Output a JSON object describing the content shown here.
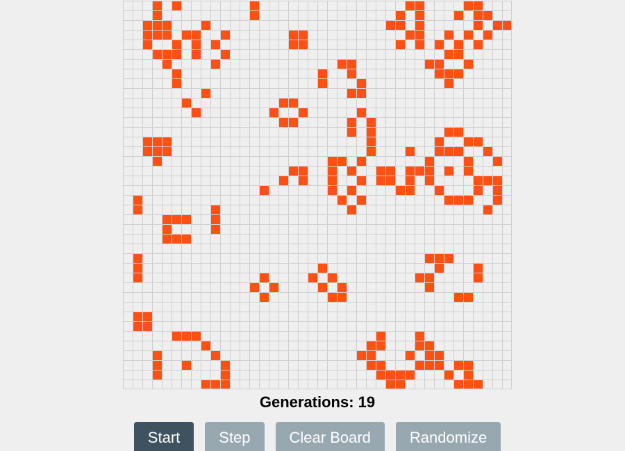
{
  "game": {
    "rows": 40,
    "cols": 40,
    "alive_color": "#ff5014",
    "dead_color": "#efefef",
    "grid_line_color": "#cfcfcf",
    "alive_cells": [
      [
        0,
        3
      ],
      [
        0,
        5
      ],
      [
        0,
        13
      ],
      [
        0,
        29
      ],
      [
        0,
        30
      ],
      [
        0,
        35
      ],
      [
        0,
        36
      ],
      [
        1,
        3
      ],
      [
        1,
        13
      ],
      [
        1,
        28
      ],
      [
        1,
        30
      ],
      [
        1,
        34
      ],
      [
        1,
        36
      ],
      [
        1,
        37
      ],
      [
        2,
        2
      ],
      [
        2,
        3
      ],
      [
        2,
        4
      ],
      [
        2,
        8
      ],
      [
        2,
        27
      ],
      [
        2,
        28
      ],
      [
        2,
        30
      ],
      [
        2,
        36
      ],
      [
        2,
        38
      ],
      [
        2,
        39
      ],
      [
        3,
        2
      ],
      [
        3,
        3
      ],
      [
        3,
        4
      ],
      [
        3,
        6
      ],
      [
        3,
        7
      ],
      [
        3,
        10
      ],
      [
        3,
        17
      ],
      [
        3,
        18
      ],
      [
        3,
        29
      ],
      [
        3,
        30
      ],
      [
        3,
        33
      ],
      [
        3,
        35
      ],
      [
        3,
        37
      ],
      [
        4,
        2
      ],
      [
        4,
        5
      ],
      [
        4,
        7
      ],
      [
        4,
        9
      ],
      [
        4,
        17
      ],
      [
        4,
        18
      ],
      [
        4,
        28
      ],
      [
        4,
        30
      ],
      [
        4,
        32
      ],
      [
        4,
        34
      ],
      [
        4,
        36
      ],
      [
        5,
        3
      ],
      [
        5,
        4
      ],
      [
        5,
        5
      ],
      [
        5,
        7
      ],
      [
        5,
        10
      ],
      [
        5,
        33
      ],
      [
        5,
        34
      ],
      [
        6,
        4
      ],
      [
        6,
        9
      ],
      [
        6,
        22
      ],
      [
        6,
        23
      ],
      [
        6,
        31
      ],
      [
        6,
        32
      ],
      [
        6,
        35
      ],
      [
        7,
        5
      ],
      [
        7,
        20
      ],
      [
        7,
        23
      ],
      [
        7,
        32
      ],
      [
        7,
        33
      ],
      [
        7,
        34
      ],
      [
        8,
        5
      ],
      [
        8,
        20
      ],
      [
        8,
        24
      ],
      [
        8,
        33
      ],
      [
        9,
        8
      ],
      [
        9,
        23
      ],
      [
        9,
        24
      ],
      [
        10,
        6
      ],
      [
        10,
        16
      ],
      [
        10,
        17
      ],
      [
        11,
        7
      ],
      [
        11,
        15
      ],
      [
        11,
        18
      ],
      [
        11,
        24
      ],
      [
        12,
        16
      ],
      [
        12,
        17
      ],
      [
        12,
        23
      ],
      [
        12,
        25
      ],
      [
        13,
        23
      ],
      [
        13,
        25
      ],
      [
        13,
        33
      ],
      [
        13,
        34
      ],
      [
        14,
        2
      ],
      [
        14,
        3
      ],
      [
        14,
        4
      ],
      [
        14,
        25
      ],
      [
        14,
        32
      ],
      [
        14,
        35
      ],
      [
        14,
        36
      ],
      [
        15,
        2
      ],
      [
        15,
        3
      ],
      [
        15,
        4
      ],
      [
        15,
        25
      ],
      [
        15,
        29
      ],
      [
        15,
        32
      ],
      [
        15,
        33
      ],
      [
        15,
        34
      ],
      [
        15,
        37
      ],
      [
        16,
        3
      ],
      [
        16,
        21
      ],
      [
        16,
        22
      ],
      [
        16,
        24
      ],
      [
        16,
        31
      ],
      [
        16,
        35
      ],
      [
        16,
        38
      ],
      [
        17,
        17
      ],
      [
        17,
        18
      ],
      [
        17,
        21
      ],
      [
        17,
        23
      ],
      [
        17,
        26
      ],
      [
        17,
        27
      ],
      [
        17,
        29
      ],
      [
        17,
        30
      ],
      [
        17,
        31
      ],
      [
        17,
        33
      ],
      [
        17,
        35
      ],
      [
        18,
        16
      ],
      [
        18,
        18
      ],
      [
        18,
        21
      ],
      [
        18,
        24
      ],
      [
        18,
        26
      ],
      [
        18,
        27
      ],
      [
        18,
        29
      ],
      [
        18,
        31
      ],
      [
        18,
        36
      ],
      [
        18,
        37
      ],
      [
        18,
        38
      ],
      [
        19,
        14
      ],
      [
        19,
        21
      ],
      [
        19,
        23
      ],
      [
        19,
        28
      ],
      [
        19,
        29
      ],
      [
        19,
        32
      ],
      [
        19,
        36
      ],
      [
        19,
        38
      ],
      [
        20,
        1
      ],
      [
        20,
        22
      ],
      [
        20,
        24
      ],
      [
        20,
        33
      ],
      [
        20,
        34
      ],
      [
        20,
        35
      ],
      [
        20,
        38
      ],
      [
        21,
        1
      ],
      [
        21,
        9
      ],
      [
        21,
        23
      ],
      [
        21,
        37
      ],
      [
        22,
        4
      ],
      [
        22,
        5
      ],
      [
        22,
        6
      ],
      [
        22,
        9
      ],
      [
        23,
        4
      ],
      [
        23,
        9
      ],
      [
        24,
        4
      ],
      [
        24,
        5
      ],
      [
        24,
        6
      ],
      [
        26,
        1
      ],
      [
        26,
        31
      ],
      [
        26,
        32
      ],
      [
        26,
        33
      ],
      [
        27,
        1
      ],
      [
        27,
        20
      ],
      [
        27,
        32
      ],
      [
        27,
        36
      ],
      [
        28,
        1
      ],
      [
        28,
        14
      ],
      [
        28,
        19
      ],
      [
        28,
        21
      ],
      [
        28,
        30
      ],
      [
        28,
        31
      ],
      [
        28,
        36
      ],
      [
        29,
        13
      ],
      [
        29,
        15
      ],
      [
        29,
        20
      ],
      [
        29,
        22
      ],
      [
        29,
        31
      ],
      [
        30,
        14
      ],
      [
        30,
        21
      ],
      [
        30,
        22
      ],
      [
        30,
        34
      ],
      [
        30,
        35
      ],
      [
        32,
        1
      ],
      [
        32,
        2
      ],
      [
        33,
        1
      ],
      [
        33,
        2
      ],
      [
        34,
        5
      ],
      [
        34,
        6
      ],
      [
        34,
        7
      ],
      [
        34,
        26
      ],
      [
        34,
        30
      ],
      [
        35,
        8
      ],
      [
        35,
        25
      ],
      [
        35,
        26
      ],
      [
        35,
        30
      ],
      [
        35,
        31
      ],
      [
        36,
        3
      ],
      [
        36,
        9
      ],
      [
        36,
        24
      ],
      [
        36,
        25
      ],
      [
        36,
        29
      ],
      [
        36,
        31
      ],
      [
        36,
        32
      ],
      [
        37,
        3
      ],
      [
        37,
        6
      ],
      [
        37,
        10
      ],
      [
        37,
        25
      ],
      [
        37,
        26
      ],
      [
        37,
        30
      ],
      [
        37,
        31
      ],
      [
        37,
        32
      ],
      [
        37,
        34
      ],
      [
        37,
        35
      ],
      [
        38,
        3
      ],
      [
        38,
        10
      ],
      [
        38,
        26
      ],
      [
        38,
        27
      ],
      [
        38,
        28
      ],
      [
        38,
        29
      ],
      [
        38,
        33
      ],
      [
        38,
        35
      ],
      [
        39,
        8
      ],
      [
        39,
        9
      ],
      [
        39,
        10
      ],
      [
        39,
        27
      ],
      [
        39,
        28
      ],
      [
        39,
        34
      ],
      [
        39,
        35
      ],
      [
        39,
        36
      ]
    ]
  },
  "status": {
    "generations_label": "Generations: 19"
  },
  "controls": {
    "start_label": "Start",
    "step_label": "Step",
    "clear_label": "Clear Board",
    "randomize_label": "Randomize",
    "primary_color": "#3e5260",
    "secondary_color": "#98a8b1"
  }
}
